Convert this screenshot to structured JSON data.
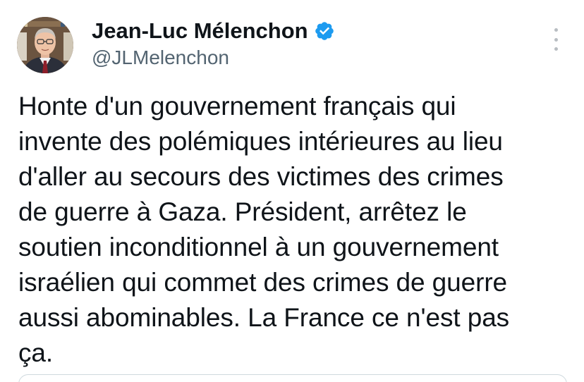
{
  "author": {
    "display_name": "Jean-Luc Mélenchon",
    "handle": "@JLMelenchon",
    "verified": true,
    "verified_color": "#1d9bf0"
  },
  "menu": {
    "icon": "more-vertical-icon"
  },
  "tweet": {
    "lines": [
      "Honte d'un gouvernement français qui",
      "invente des polémiques intérieures au lieu",
      "d'aller au secours des victimes des crimes",
      "de guerre à Gaza. Président, arrêtez le",
      "soutien inconditionnel à un gouvernement",
      "israélien qui commet des crimes de guerre",
      "aussi abominables. La France ce n'est pas",
      "ça."
    ]
  },
  "colors": {
    "text": "#0f1419",
    "secondary": "#536471",
    "border": "#cfd9de"
  }
}
